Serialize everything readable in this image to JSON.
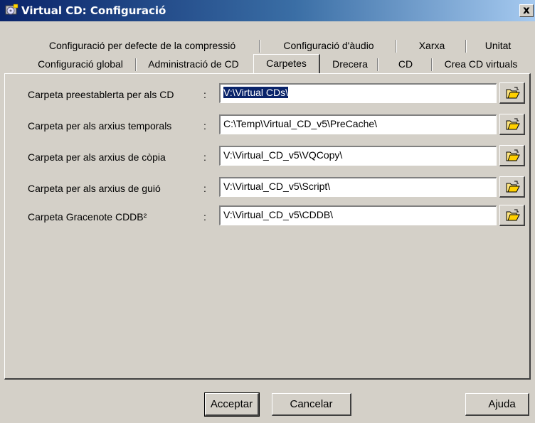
{
  "window": {
    "title": "Virtual CD: Configuració",
    "close_label": "x"
  },
  "tabs_row1": [
    "Configuració per defecte de la compressió",
    "Configuració d'àudio",
    "Xarxa",
    "Unitat"
  ],
  "tabs_row2": [
    "Configuració global",
    "Administració de CD",
    "Carpetes",
    "Drecera",
    "CD",
    "Crea CD virtuals"
  ],
  "active_tab": "Carpetes",
  "folders": [
    {
      "label": "Carpeta preestablerta per als CD",
      "colon": ":",
      "value": "V:\\Virtual CDs\\",
      "selected": true
    },
    {
      "label": "Carpeta per als arxius temporals",
      "colon": ":",
      "value": "C:\\Temp\\Virtual_CD_v5\\PreCache\\"
    },
    {
      "label": "Carpeta per als arxius de còpia",
      "colon": ":",
      "value": "V:\\Virtual_CD_v5\\VQCopy\\"
    },
    {
      "label": "Carpeta per als arxius de guió",
      "colon": ":",
      "value": "V:\\Virtual_CD_v5\\Script\\"
    },
    {
      "label": "Carpeta Gracenote CDDB²",
      "colon": ":",
      "value": "V:\\Virtual_CD_v5\\CDDB\\"
    }
  ],
  "buttons": {
    "ok": "Acceptar",
    "cancel": "Cancelar",
    "help": "Ajuda"
  },
  "colors": {
    "titlebar": "#0a246a",
    "face": "#d4d0c8",
    "selection": "#0a246a"
  },
  "icons": {
    "app": "virtual-cd-app-icon",
    "browse": "open-folder-icon"
  }
}
